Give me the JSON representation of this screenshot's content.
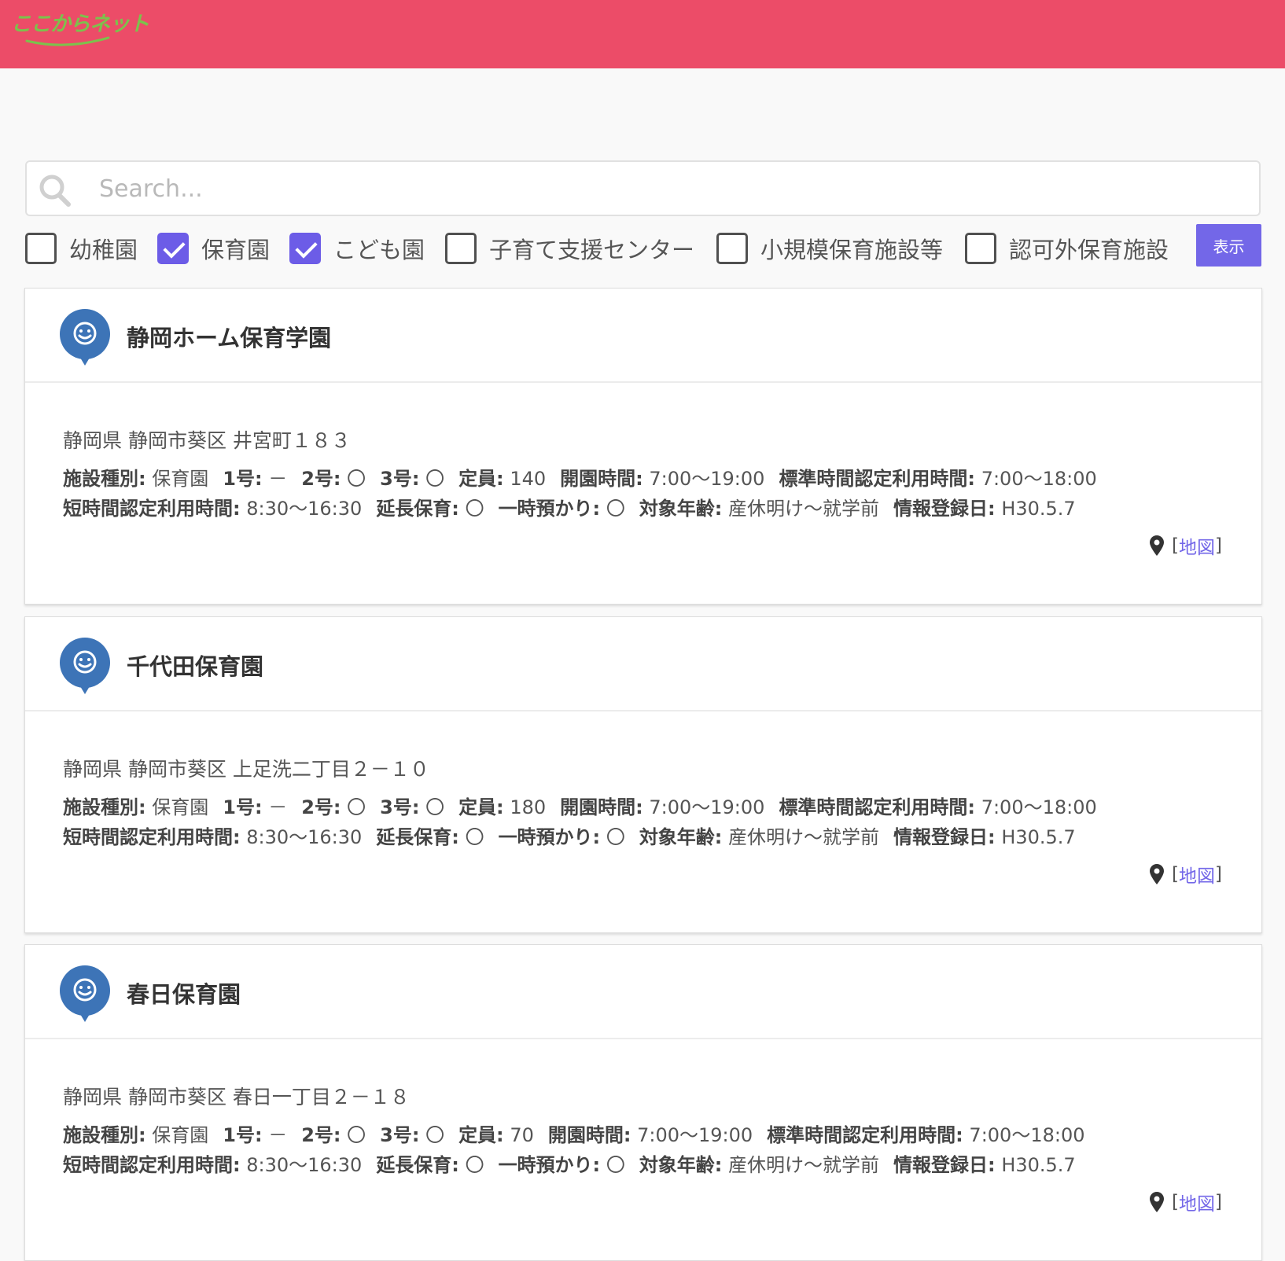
{
  "header": {
    "logo_text": "ここからネット",
    "brand_color": "#ec4c68",
    "logo_color": "#7cc24c"
  },
  "search": {
    "placeholder": "Search...",
    "value": ""
  },
  "filters": {
    "options": [
      {
        "label": "幼稚園",
        "checked": false
      },
      {
        "label": "保育園",
        "checked": true
      },
      {
        "label": "こども園",
        "checked": true
      },
      {
        "label": "子育て支援センター",
        "checked": false
      },
      {
        "label": "小規模保育施設等",
        "checked": false
      },
      {
        "label": "認可外保育施設",
        "checked": false
      }
    ],
    "submit_label": "表示",
    "accent_color": "#7367e8"
  },
  "field_labels": {
    "type": "施設種別:",
    "no1": "1号:",
    "no2": "2号:",
    "no3": "3号:",
    "capacity": "定員:",
    "open_hours": "開園時間:",
    "standard_hours": "標準時間認定利用時間:",
    "short_hours": "短時間認定利用時間:",
    "extended": "延長保育:",
    "temporary": "一時預かり:",
    "age": "対象年齢:",
    "registered": "情報登録日:"
  },
  "results": [
    {
      "name": "静岡ホーム保育学園",
      "address": "静岡県 静岡市葵区 井宮町１８３",
      "type": "保育園",
      "no1": "－",
      "no2": "〇",
      "no3": "〇",
      "capacity": "140",
      "open_hours": "7:00～19:00",
      "standard_hours": "7:00～18:00",
      "short_hours": "8:30～16:30",
      "extended": "〇",
      "temporary": "〇",
      "age": "産休明け～就学前",
      "registered": "H30.5.7",
      "map_label": "地図"
    },
    {
      "name": "千代田保育園",
      "address": "静岡県 静岡市葵区 上足洗二丁目２－１０",
      "type": "保育園",
      "no1": "－",
      "no2": "〇",
      "no3": "〇",
      "capacity": "180",
      "open_hours": "7:00～19:00",
      "standard_hours": "7:00～18:00",
      "short_hours": "8:30～16:30",
      "extended": "〇",
      "temporary": "〇",
      "age": "産休明け～就学前",
      "registered": "H30.5.7",
      "map_label": "地図"
    },
    {
      "name": "春日保育園",
      "address": "静岡県 静岡市葵区 春日一丁目２－１８",
      "type": "保育園",
      "no1": "－",
      "no2": "〇",
      "no3": "〇",
      "capacity": "70",
      "open_hours": "7:00～19:00",
      "standard_hours": "7:00～18:00",
      "short_hours": "8:30～16:30",
      "extended": "〇",
      "temporary": "〇",
      "age": "産休明け～就学前",
      "registered": "H30.5.7",
      "map_label": "地図"
    }
  ]
}
